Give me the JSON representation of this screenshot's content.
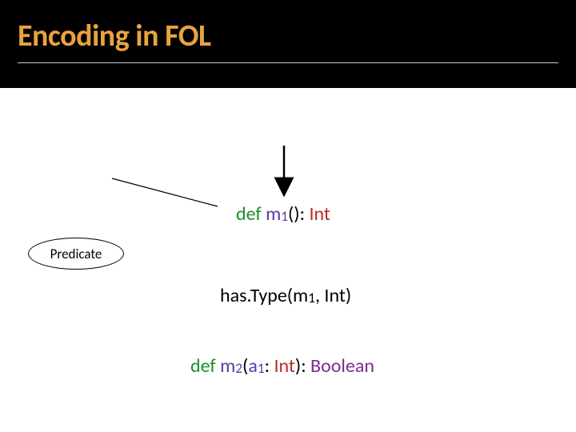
{
  "title": "Encoding in FOL",
  "predicate_label": "Predicate",
  "code1": {
    "def": "def ",
    "name_a": "m",
    "name_sub": "1",
    "args": "(): ",
    "ret": "Int"
  },
  "formula": {
    "pred": "has.Type(m",
    "argsub": "1",
    "rest": ", Int)"
  },
  "code2": {
    "def": "def ",
    "name_a": "m",
    "name_sub": "2",
    "lpar": "(",
    "arg_a": "a",
    "arg_sub": "1",
    "colon": ": ",
    "argty": "Int",
    "rpar": "): ",
    "ret": "Boolean"
  }
}
